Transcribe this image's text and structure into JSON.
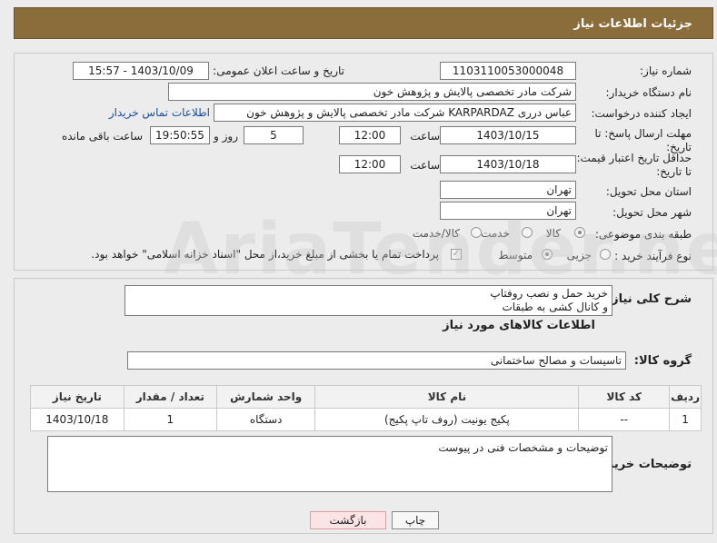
{
  "header": {
    "title": "جزئیات اطلاعات نیاز"
  },
  "info": {
    "need_number_label": "شماره نیاز:",
    "need_number": "1103110053000048",
    "announce_label": "تاریخ و ساعت اعلان عمومی:",
    "announce_value": "1403/10/09 - 15:57",
    "buyer_label": "نام دستگاه خریدار:",
    "buyer_value": "شرکت مادر تخصصی پالایش و پژوهش خون",
    "creator_label": "ایجاد کننده درخواست:",
    "creator_value": "عباس درری KARPARDAZ شرکت مادر تخصصی پالایش و پژوهش خون",
    "contact_link": "اطلاعات تماس خریدار",
    "deadline_label": "مهلت ارسال پاسخ: تا تاریخ:",
    "deadline_date": "1403/10/15",
    "time_label": "ساعت",
    "deadline_time": "12:00",
    "days_value": "5",
    "days_label": "روز و",
    "remaining_time": "19:50:55",
    "remaining_label": "ساعت باقی مانده",
    "validity_label": "حداقل تاریخ اعتبار قیمت: تا تاریخ:",
    "validity_date": "1403/10/18",
    "validity_time": "12:00",
    "province_label": "استان محل تحویل:",
    "province_value": "تهران",
    "city_label": "شهر محل تحویل:",
    "city_value": "تهران",
    "category_label": "طبقه بندی موضوعی:",
    "category_options": [
      "کالا",
      "خدمت",
      "کالا/خدمت"
    ],
    "process_label": "نوع فرآیند خرید :",
    "process_options": [
      "جزیی",
      "متوسط"
    ],
    "process_note": "پرداخت تمام یا بخشی از مبلغ خرید،از محل \"اسناد خزانه اسلامی\" خواهد بود."
  },
  "description": {
    "label": "شرح کلی نیاز:",
    "value_line1": "خرید حمل و نصب روفتاپ",
    "value_line2": "و کانال کشی به طبقات",
    "goods_info_title": "اطلاعات کالاهای مورد نیاز",
    "group_label": "گروه کالا:",
    "group_value": "تاسیسات و مصالح ساختمانی"
  },
  "table": {
    "headers": [
      "ردیف",
      "کد کالا",
      "نام کالا",
      "واحد شمارش",
      "تعداد / مقدار",
      "تاریخ نیاز"
    ],
    "rows": [
      [
        "1",
        "--",
        "پکیج یونیت (روف تاپ پکیج)",
        "دستگاه",
        "1",
        "1403/10/18"
      ]
    ]
  },
  "buyer_notes": {
    "label": "توضیحات خریدار:",
    "value": "توضیحات و مشخصات فنی در پیوست"
  },
  "buttons": {
    "print": "چاپ",
    "back": "بازگشت"
  },
  "watermark": "AriaTender.neT"
}
